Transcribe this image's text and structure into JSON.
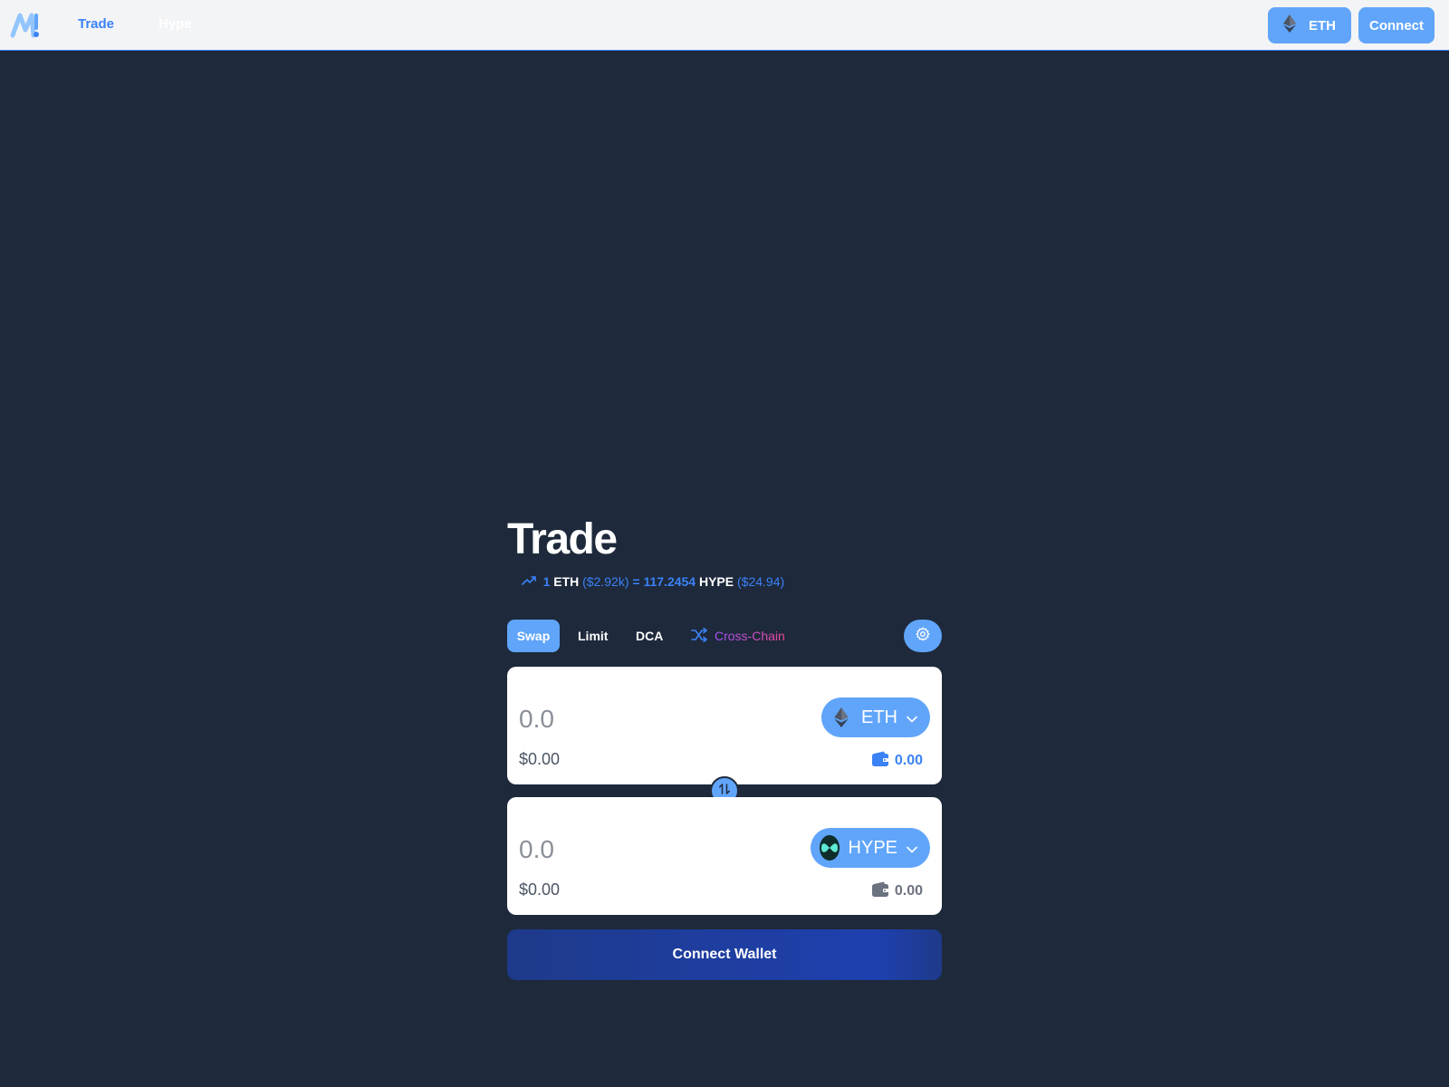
{
  "topbar": {
    "nav": [
      {
        "label": "Trade",
        "active": true
      },
      {
        "label": "Hype",
        "active": false
      }
    ],
    "chain_label": "ETH",
    "connect_label": "Connect"
  },
  "main": {
    "title": "Trade",
    "rate": {
      "base_amount": "1",
      "base_symbol": "ETH",
      "base_usd": "($2.92k)",
      "equals": "=",
      "quote_amount": "117.2454",
      "quote_symbol": "HYPE",
      "quote_usd": "($24.94)"
    },
    "tabs": [
      {
        "label": "Swap",
        "active": true
      },
      {
        "label": "Limit",
        "active": false
      },
      {
        "label": "DCA",
        "active": false
      },
      {
        "label": "Cross-Chain",
        "active": false
      }
    ],
    "sell": {
      "placeholder": "0.0",
      "usd_value": "$0.00",
      "token": "ETH",
      "balance": "0.00"
    },
    "buy": {
      "placeholder": "0.0",
      "usd_value": "$0.00",
      "token": "HYPE",
      "balance": "0.00"
    },
    "connect_wallet_label": "Connect Wallet"
  },
  "colors": {
    "background": "#1e293b",
    "accent": "#60a5fa",
    "accent_text": "#3b82f6",
    "button_dark": "#1e40af"
  }
}
